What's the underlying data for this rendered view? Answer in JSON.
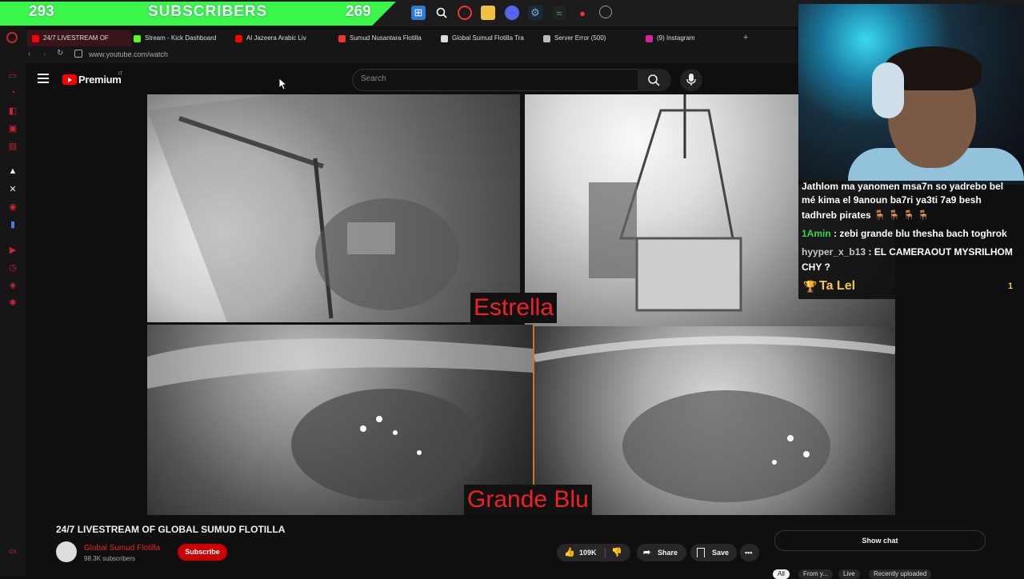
{
  "stream_overlay": {
    "sub_count_left": "293",
    "sub_label": "SUBSCRIBERS",
    "sub_count_right": "269"
  },
  "browser": {
    "tabs": [
      {
        "label": "24/7 LIVESTREAM OF"
      },
      {
        "label": "Stream - Kick Dashboard"
      },
      {
        "label": "Al Jazeera Arabic Liv"
      },
      {
        "label": "Sumud Nusantara Flotilla"
      },
      {
        "label": "Global Sumud Flotilla Tra"
      },
      {
        "label": "Server Error (500)"
      },
      {
        "label": "(9) Instagram"
      }
    ],
    "new_tab": "+",
    "url": "www.youtube.com/watch"
  },
  "youtube": {
    "logo_text": "Premium",
    "country": "IT",
    "search_placeholder": "Search"
  },
  "video": {
    "label_top": "Estrella",
    "label_bottom": "Grande Blu",
    "title": "24/7 LIVESTREAM OF GLOBAL SUMUD FLOTILLA",
    "channel_name": "Global Sumud Flotilla",
    "channel_subs": "98.3K subscribers",
    "subscribe_label": "Subscribe",
    "likes": "109K",
    "share_label": "Share",
    "save_label": "Save",
    "show_chat_label": "Show chat",
    "chips": [
      "All",
      "From y...",
      "Live",
      "Recently uploaded"
    ]
  },
  "chat": {
    "messages": [
      {
        "user": "",
        "text": "Jathlom ma yanomen msa7n so yadrebo bel"
      },
      {
        "user": "",
        "text": "mé kima el 9anoun ba7ri ya3ti 7a9 besh"
      },
      {
        "user": "",
        "text": "tadhreb pirates 🪑 🪑 🪑 🪑"
      },
      {
        "user": "1Amin",
        "text": ": zebi grande blu thesha bach toghrok"
      },
      {
        "user": "hyyper_x_b13",
        "text": ": EL CAMERAOUT MYSRILHOM"
      },
      {
        "user": "",
        "text": "CHY ?"
      }
    ],
    "top_supporter": "Ta Lel",
    "top_supporter_count": "1"
  },
  "colors": {
    "sub_bar": "#3cf54a",
    "yt_red": "#ff0000",
    "chat_user_green": "#32d74b",
    "chat_user_gray": "#c8c8c8",
    "cam_label": "#e22222"
  }
}
